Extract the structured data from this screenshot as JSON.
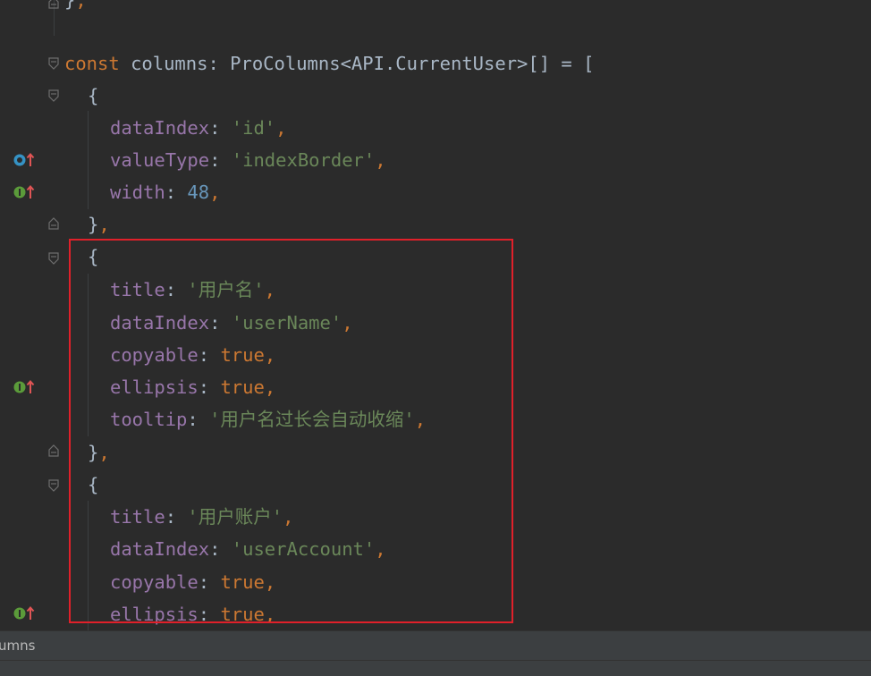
{
  "editor": {
    "lines": {
      "l0": {
        "close": "}",
        "comma": ","
      },
      "l1": {
        "kw": "const",
        "name": "columns",
        "colon": ":",
        "type": "ProColumns<API.CurrentUser>[]",
        "eq": "=",
        "bracket": "["
      },
      "l2": {
        "brace": "{"
      },
      "l3": {
        "prop": "dataIndex",
        "colon": ":",
        "value": "'id'",
        "comma": ","
      },
      "l4": {
        "prop": "valueType",
        "colon": ":",
        "value": "'indexBorder'",
        "comma": ","
      },
      "l5": {
        "prop": "width",
        "colon": ":",
        "value": "48",
        "comma": ","
      },
      "l6": {
        "brace": "}",
        "comma": ","
      },
      "l7": {
        "brace": "{"
      },
      "l8": {
        "prop": "title",
        "colon": ":",
        "value": "'用户名'",
        "comma": ","
      },
      "l9": {
        "prop": "dataIndex",
        "colon": ":",
        "value": "'userName'",
        "comma": ","
      },
      "l10": {
        "prop": "copyable",
        "colon": ":",
        "value": "true",
        "comma": ","
      },
      "l11": {
        "prop": "ellipsis",
        "colon": ":",
        "value": "true",
        "comma": ","
      },
      "l12": {
        "prop": "tooltip",
        "colon": ":",
        "value": "'用户名过长会自动收缩'",
        "comma": ","
      },
      "l13": {
        "brace": "}",
        "comma": ","
      },
      "l14": {
        "brace": "{"
      },
      "l15": {
        "prop": "title",
        "colon": ":",
        "value": "'用户账户'",
        "comma": ","
      },
      "l16": {
        "prop": "dataIndex",
        "colon": ":",
        "value": "'userAccount'",
        "comma": ","
      },
      "l17": {
        "prop": "copyable",
        "colon": ":",
        "value": "true",
        "comma": ","
      },
      "l18": {
        "prop": "ellipsis",
        "colon": ":",
        "value": "true",
        "comma": ","
      }
    }
  },
  "breadcrumb": {
    "text": "umns"
  },
  "gutter_icons": [
    "overrides-icon",
    "implements-icon",
    "implements-icon",
    "implements-icon"
  ],
  "colors": {
    "background": "#2b2b2b",
    "keyword": "#cc7832",
    "property": "#9876aa",
    "string": "#6a8759",
    "number": "#6897bb",
    "text": "#a9b7c6",
    "highlight_box": "#e0202a"
  }
}
